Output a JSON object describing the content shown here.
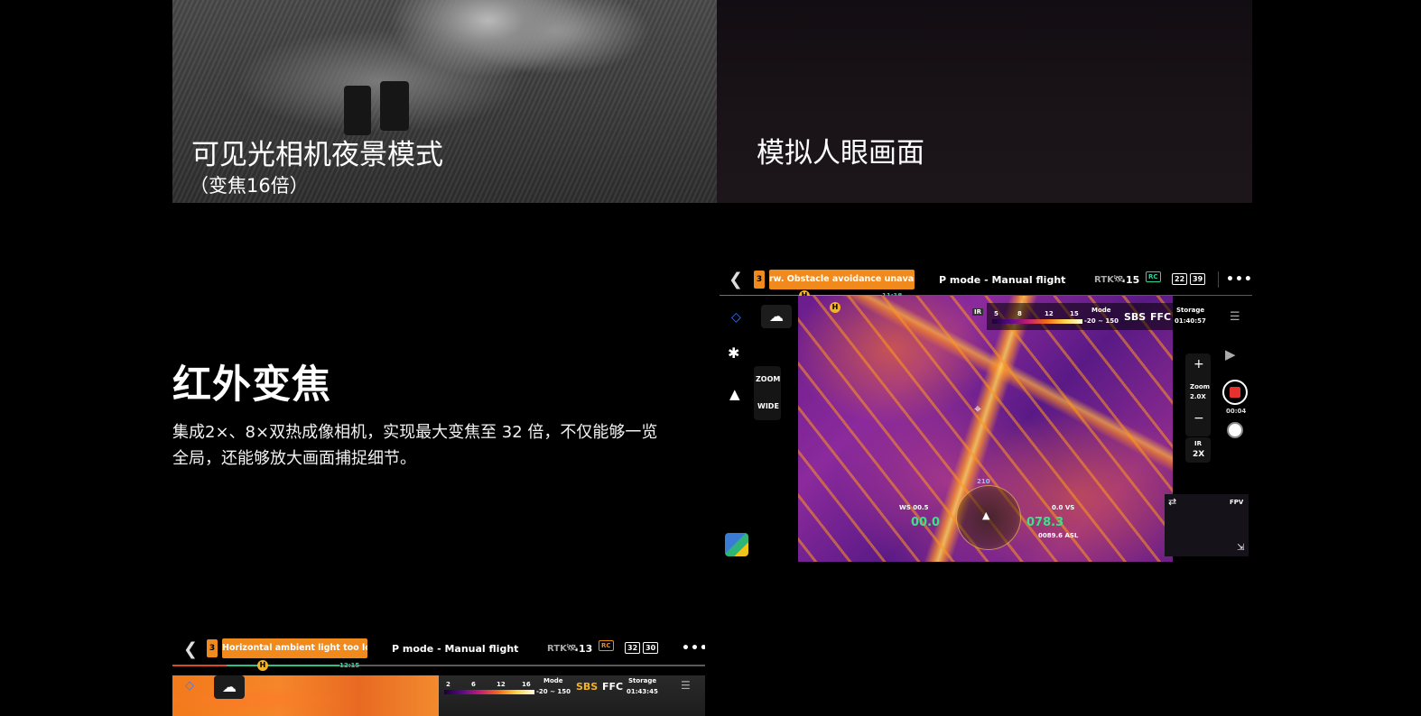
{
  "top_panels": {
    "left_caption": "可见光相机夜景模式",
    "left_subcaption": "（变焦16倍）",
    "right_caption": "模拟人眼画面"
  },
  "section": {
    "heading": "红外变焦",
    "paragraph": "集成2×、8×双热成像相机，实现最大变焦至 32 倍，不仅能够一览全局，还能够放大画面捕捉细节。"
  },
  "drone_ui_main": {
    "warning_count": "3",
    "warning_text": "rw. Obstacle avoidance unavailabl",
    "flight_mode": "P mode - Manual flight",
    "rtk": "RTK",
    "satellites": "15",
    "rc": "RC",
    "battery_rc": "22",
    "battery_aircraft": "39",
    "menu": "•••",
    "timeline_time": "11:18",
    "home": "H",
    "ir_label": "IR",
    "palette_ticks": [
      "8",
      "12",
      "15"
    ],
    "palette_low": "5",
    "mode_label": "Mode",
    "mode_range": "-20 ~ 150",
    "sbs": "SBS",
    "ffc": "FFC",
    "storage_label": "Storage",
    "storage_value": "01:40:57",
    "zoom_btn": "ZOOM",
    "wide_btn": "WIDE",
    "zoom_plus": "+",
    "zoom_label": "Zoom",
    "zoom_value": "2.0X",
    "zoom_minus": "−",
    "ir_zoom_label": "IR",
    "ir_zoom_value": "2X",
    "rec_time": "00:04",
    "fpv": "FPV",
    "ws": "WS 00.5",
    "speed": "00.0",
    "vs": "0.0  VS",
    "altitude": "078.3",
    "asl": "0089.6 ASL",
    "heading_num": "210"
  },
  "drone_ui_bottom": {
    "warning_count": "3",
    "warning_text": "Horizontal ambient light too low.",
    "flight_mode": "P mode - Manual flight",
    "rtk": "RTK",
    "satellites": "13",
    "rc": "RC",
    "battery_rc": "32",
    "battery_aircraft": "30",
    "menu": "•••",
    "timeline_time": "12:15",
    "home": "H",
    "palette_ticks": [
      "2",
      "6",
      "12",
      "16"
    ],
    "mode_label": "Mode",
    "mode_range": "-20 ~ 150",
    "sbs": "SBS",
    "ffc": "FFC",
    "storage_label": "Storage",
    "storage_value": "01:43:45"
  },
  "colors": {
    "warning": "#f08a1d",
    "rc_green": "#2fd49a",
    "record_red": "#e8312f",
    "sbs_yellow": "#f5b324"
  }
}
